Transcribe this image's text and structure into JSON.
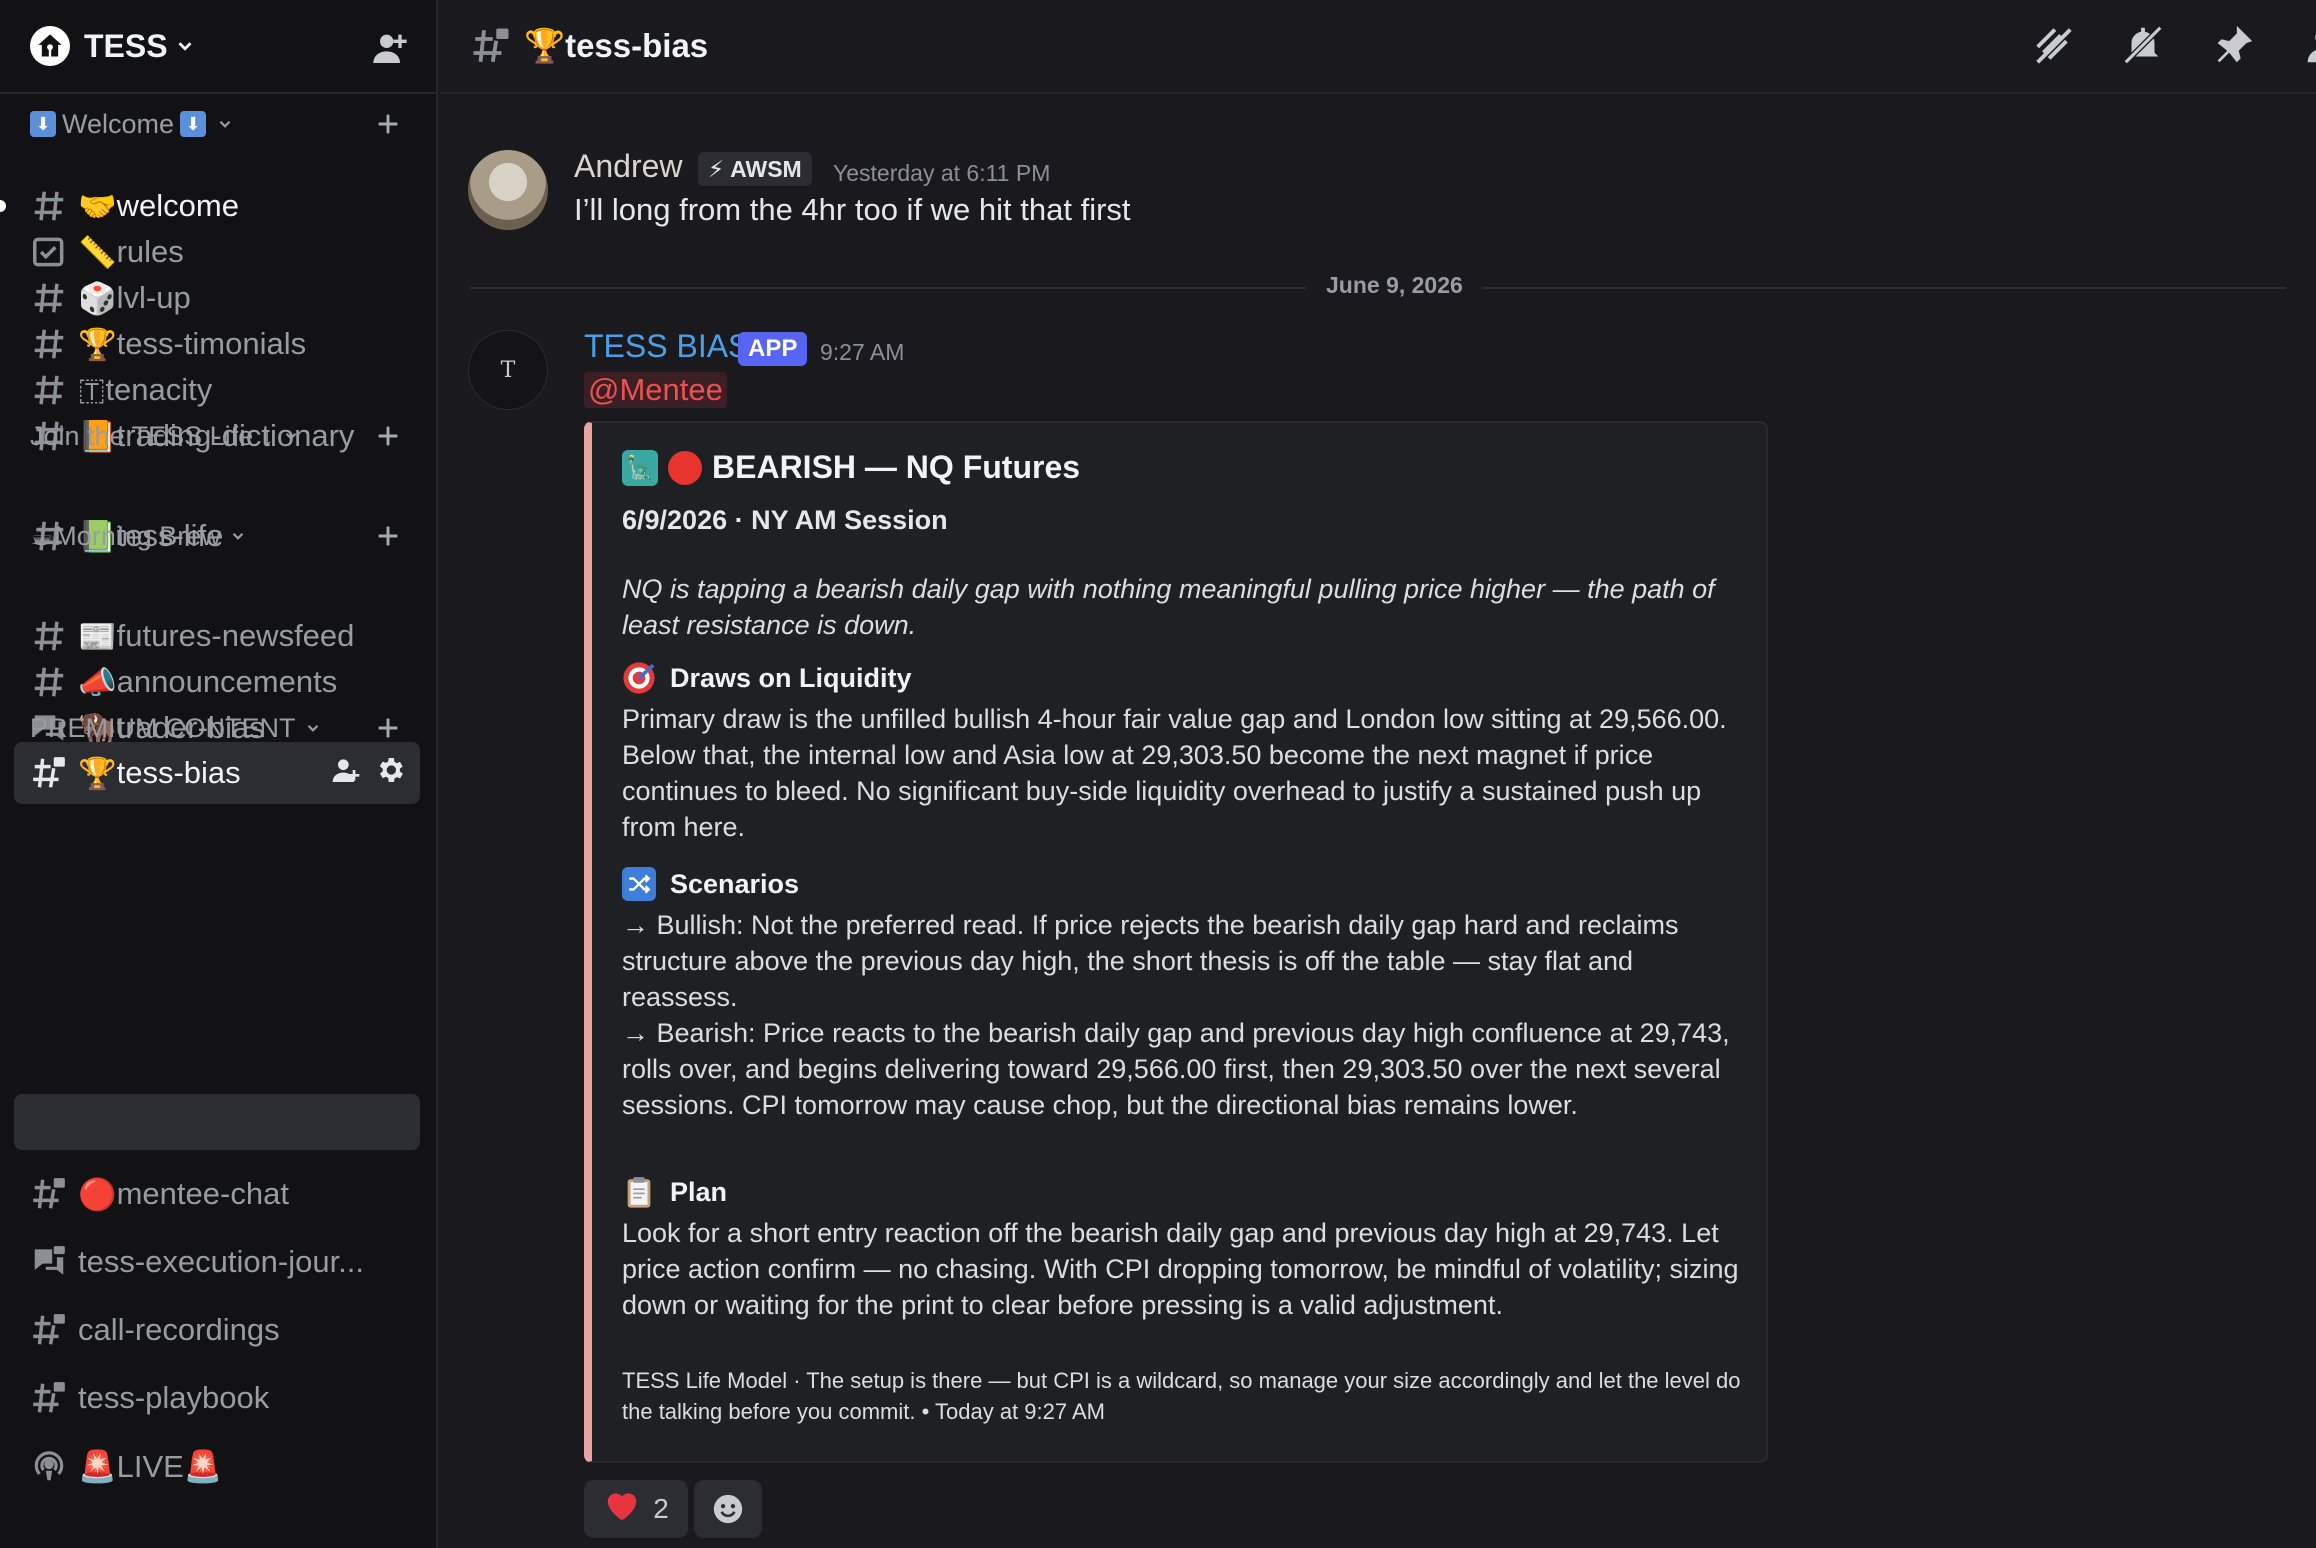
{
  "server": {
    "name": "TESS"
  },
  "categories": [
    {
      "label": "Welcome"
    },
    {
      "label": "Join the TESS Life ↓"
    },
    {
      "label": "☕Morning Brew"
    },
    {
      "label": "PREMIUM CONTENT"
    }
  ],
  "channels": [
    {
      "emoji": "🤝",
      "name": "welcome"
    },
    {
      "emoji": "📏",
      "name": "rules"
    },
    {
      "emoji": "🎲",
      "name": "lvl-up"
    },
    {
      "emoji": "🏆",
      "name": "tess-timonials"
    },
    {
      "emoji": "🇹",
      "name": "tenacity"
    },
    {
      "emoji": "📙",
      "name": "trading-dictionary"
    },
    {
      "emoji": "📗",
      "name": "tess-life"
    },
    {
      "emoji": "📰",
      "name": "futures-newsfeed"
    },
    {
      "emoji": "📣",
      "name": "announcements"
    },
    {
      "emoji": "🦬",
      "name": "trader-bias"
    },
    {
      "emoji": "🏆",
      "name": "tess-bias"
    },
    {
      "emoji": "🔴",
      "name": "mentee-chat"
    },
    {
      "emoji": "",
      "name": "tess-execution-jour..."
    },
    {
      "emoji": "",
      "name": "call-recordings"
    },
    {
      "emoji": "",
      "name": "tess-playbook"
    },
    {
      "emoji": "🚨",
      "name": "LIVE🚨"
    }
  ],
  "topbar": {
    "title": "🏆tess-bias"
  },
  "messages": [
    {
      "author": "Andrew",
      "tag": "AWSM",
      "time": "Yesterday at 6:11 PM",
      "text": "I’ll long from the 4hr too if we hit that first"
    },
    {
      "author": "TESS BIAS",
      "badge": "APP",
      "time": "9:27 AM",
      "mention": "@Mentee"
    }
  ],
  "date_divider": "June 9, 2026",
  "embed": {
    "title": "BEARISH — NQ Futures",
    "subtitle": "6/9/2026 · NY AM Session",
    "summary": "NQ is tapping a bearish daily gap with nothing meaningful pulling price higher — the path of least resistance is down.",
    "sections": [
      {
        "heading": "Draws on Liquidity",
        "body": "Primary draw is the unfilled bullish 4-hour fair value gap and London low sitting at 29,566.00. Below that, the internal low and Asia low at 29,303.50 become the next magnet if price continues to bleed. No significant buy-side liquidity overhead to justify a sustained push up from here."
      },
      {
        "heading": "Scenarios",
        "body": "→ Bullish: Not the preferred read. If price rejects the bearish daily gap hard and reclaims structure above the previous day high, the short thesis is off the table — stay flat and reassess.",
        "body2": "→ Bearish: Price reacts to the bearish daily gap and previous day high confluence at 29,743, rolls over, and begins delivering toward 29,566.00 first, then 29,303.50 over the next several sessions. CPI tomorrow may cause chop, but the directional bias remains lower."
      },
      {
        "heading": "Plan",
        "body": "Look for a short entry reaction off the bearish daily gap and previous day high at 29,743. Let price action confirm — no chasing. With CPI dropping tomorrow, be mindful of volatility; sizing down or waiting for the print to clear before pressing is a valid adjustment."
      }
    ],
    "footer": "TESS Life Model · The setup is there — but CPI is a wildcard, so manage your size accordingly and let the level do the talking before you commit. • Today at 9:27 AM"
  },
  "reactions": [
    {
      "emoji": "❤️",
      "count": "2"
    }
  ],
  "colors": {
    "accent": "#5865f2",
    "embed_border": "#e9a3a0",
    "mention": "#e8524f",
    "bot_name": "#4c9fe6"
  }
}
